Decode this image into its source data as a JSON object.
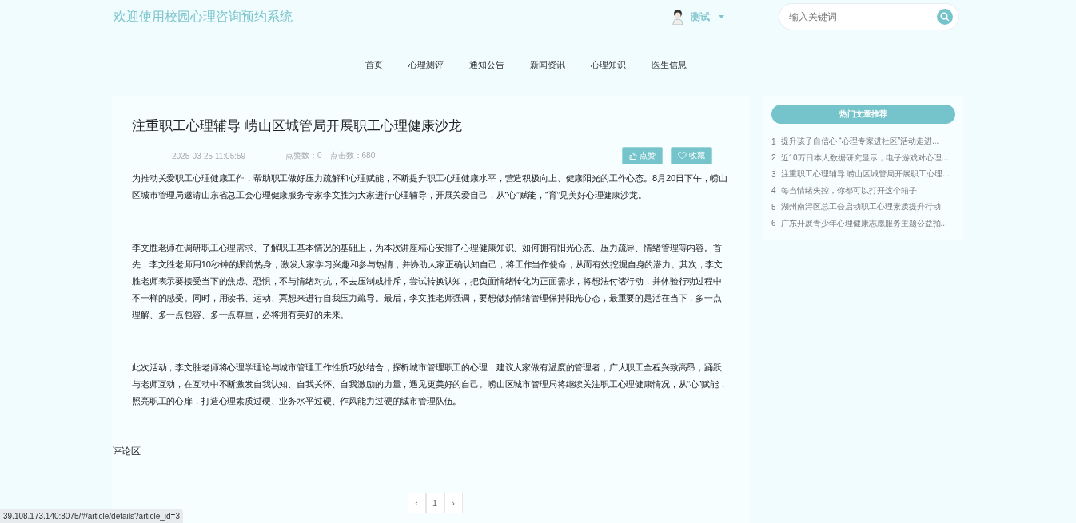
{
  "header": {
    "site_title": "欢迎使用校园心理咨询预约系统",
    "user": {
      "name": "测试"
    },
    "search": {
      "placeholder": "输入关键词"
    }
  },
  "nav": [
    {
      "label": "首页",
      "selected": false
    },
    {
      "label": "心理测评",
      "selected": false
    },
    {
      "label": "通知公告",
      "selected": false
    },
    {
      "label": "新闻资讯",
      "selected": false
    },
    {
      "label": "心理知识",
      "selected": false
    },
    {
      "label": "医生信息",
      "selected": false
    }
  ],
  "article": {
    "title": "注重职工心理辅导 崂山区城管局开展职工心理健康沙龙",
    "date": "2025-03-25 11:05:59",
    "likes": "点赞数：0",
    "clicks": "点击数：680",
    "actions": [
      {
        "kind": "like",
        "label": "点赞"
      },
      {
        "kind": "favorite",
        "label": "收藏"
      }
    ],
    "paragraphs": [
      "为推动关爱职工心理健康工作，帮助职工做好压力疏解和心理赋能，不断提升职工心理健康水平，营造积极向上、健康阳光的工作心态。8月20日下午，崂山区城市管理局邀请山东省总工会心理健康服务专家李文胜为大家进行心理辅导，开展关爱自己，从“心”赋能，“育”见美好心理健康沙龙。",
      "李文胜老师在调研职工心理需求、了解职工基本情况的基础上，为本次讲座精心安排了心理健康知识、如何拥有阳光心态、压力疏导、情绪管理等内容。首先，李文胜老师用10秒钟的课前热身，激发大家学习兴趣和参与热情，并协助大家正确认知自己，将工作当作使命，从而有效挖掘自身的潜力。其次，李文胜老师表示要接受当下的焦虑、恐惧，不与情绪对抗，不去压制或排斥，尝试转换认知，把负面情绪转化为正面需求，将想法付诸行动，并体验行动过程中不一样的感受。同时，用读书、运动、冥想来进行自我压力疏导。最后，李文胜老师强调，要想做好情绪管理保持阳光心态，最重要的是活在当下，多一点理解、多一点包容、多一点尊重，必将拥有美好的未来。",
      "此次活动，李文胜老师将心理学理论与城市管理工作性质巧妙结合，探析城市管理职工的心理，建议大家做有温度的管理者，广大职工全程兴致高昂，踊跃与老师互动，在互动中不断激发自我认知、自我关怀、自我激励的力量，遇见更美好的自己。崂山区城市管理局将继续关注职工心理健康情况，从“心”赋能，照亮职工的心扉，打造心理素质过硬、业务水平过硬、作风能力过硬的城市管理队伍。"
    ]
  },
  "comments": {
    "heading": "评论区",
    "pagination": {
      "prev": "‹",
      "pages": [
        {
          "label": "1"
        }
      ],
      "next": "›"
    }
  },
  "sidebar": {
    "heading": "热门文章推荐",
    "items": [
      {
        "rank": "1",
        "title": "提升孩子自信心 “心理专家进社区”活动走进..."
      },
      {
        "rank": "2",
        "title": "近10万日本人数据研究显示，电子游戏对心理..."
      },
      {
        "rank": "3",
        "title": "注重职工心理辅导 崂山区城管局开展职工心理..."
      },
      {
        "rank": "4",
        "title": "每当情绪失控，你都可以打开这个箱子"
      },
      {
        "rank": "5",
        "title": "湖州南浔区总工会启动职工心理素质提升行动"
      },
      {
        "rank": "6",
        "title": "广东开展青少年心理健康志愿服务主题公益拍..."
      }
    ]
  },
  "status_bar": {
    "url": "39.108.173.140:8075/#/article/details?article_id=3"
  }
}
